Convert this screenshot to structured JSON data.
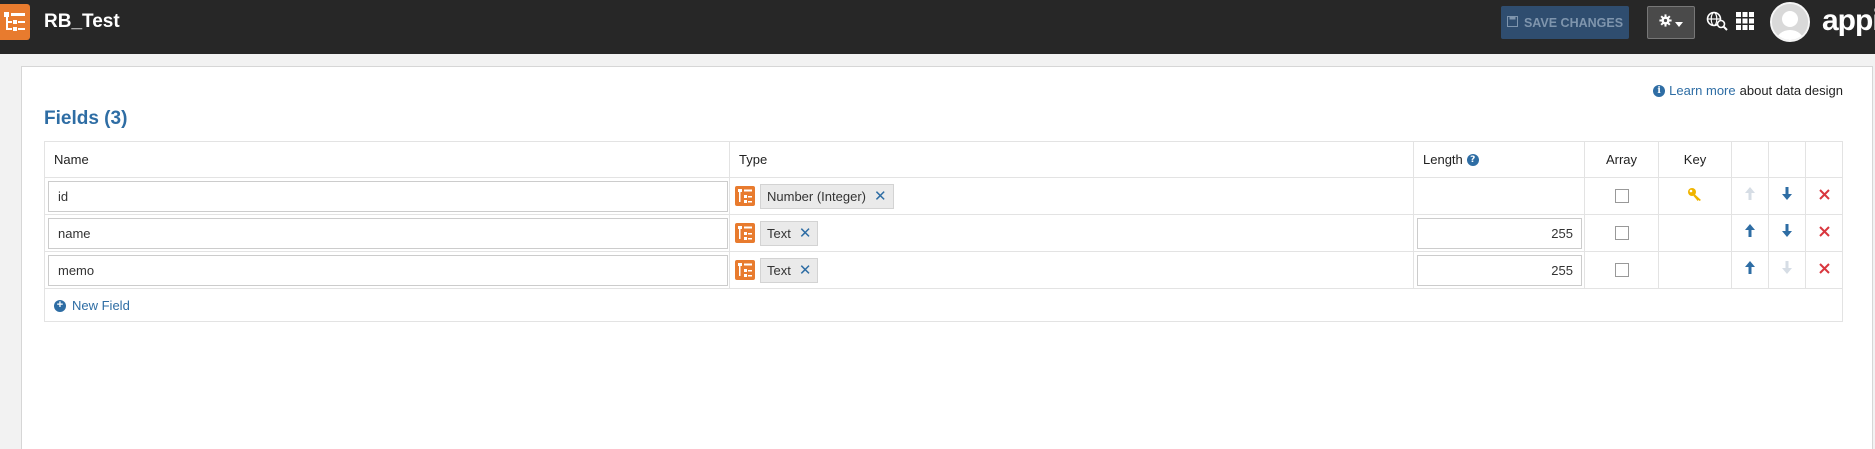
{
  "header": {
    "app_title": "RB_Test",
    "save_label": "SAVE CHANGES",
    "brand": "appia",
    "icons": [
      "record-type-icon",
      "save-icon",
      "gear-icon",
      "chevron-down-icon",
      "globe-search-icon",
      "app-grid-icon",
      "user-avatar"
    ]
  },
  "help": {
    "link_label": "Learn more",
    "suffix": "about data design"
  },
  "fields": {
    "title": "Fields (3)",
    "columns": {
      "name": "Name",
      "type": "Type",
      "length": "Length",
      "array": "Array",
      "key": "Key"
    },
    "rows": [
      {
        "name": "id",
        "type": "Number (Integer)",
        "length": "",
        "array": false,
        "key": true
      },
      {
        "name": "name",
        "type": "Text",
        "length": "255",
        "array": false,
        "key": false
      },
      {
        "name": "memo",
        "type": "Text",
        "length": "255",
        "array": false,
        "key": false
      }
    ],
    "new_field_label": "New Field"
  },
  "colors": {
    "topbar": "#272727",
    "accent_blue": "#2e6da4",
    "record_orange": "#e87b2e",
    "delete_red": "#d9363e",
    "key_yellow": "#f0b400"
  }
}
